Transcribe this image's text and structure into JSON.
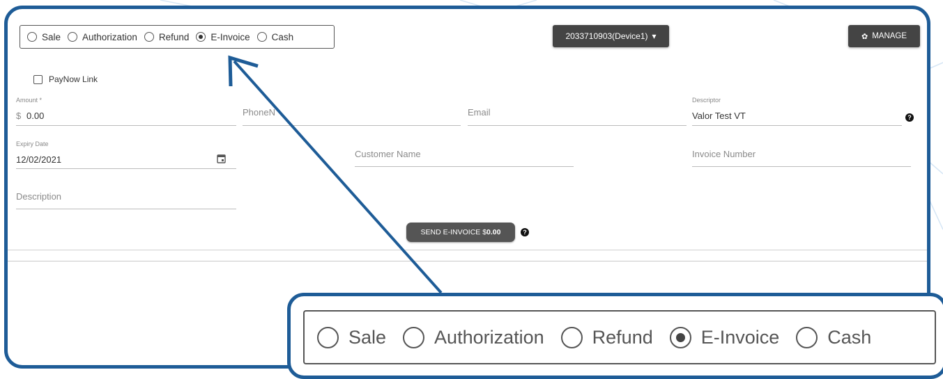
{
  "transaction_types": [
    {
      "label": "Sale",
      "checked": false
    },
    {
      "label": "Authorization",
      "checked": false
    },
    {
      "label": "Refund",
      "checked": false
    },
    {
      "label": "E-Invoice",
      "checked": true
    },
    {
      "label": "Cash",
      "checked": false
    }
  ],
  "device_dropdown": {
    "label": "2033710903(Device1)",
    "icon": "caret-down-icon"
  },
  "manage_button": {
    "label": "MANAGE",
    "icon": "gear-icon"
  },
  "paynow": {
    "label": "PayNow Link",
    "checked": false
  },
  "form": {
    "amount": {
      "label": "Amount *",
      "prefix": "$",
      "value": "0.00"
    },
    "phone": {
      "placeholder": "PhoneN"
    },
    "email": {
      "placeholder": "Email"
    },
    "descriptor": {
      "label": "Descriptor",
      "value": "Valor Test VT"
    },
    "expiry": {
      "label": "Expiry Date",
      "value": "12/02/2021",
      "icon": "calendar-icon"
    },
    "customer_name": {
      "placeholder": "Customer Name"
    },
    "invoice_number": {
      "placeholder": "Invoice Number"
    },
    "description": {
      "placeholder": "Description"
    }
  },
  "send_button": {
    "label_prefix": "SEND E-INVOICE $",
    "amount": "0.00"
  },
  "help_icon": "?",
  "colors": {
    "accent": "#1e5c97",
    "button_bg": "#444444"
  }
}
